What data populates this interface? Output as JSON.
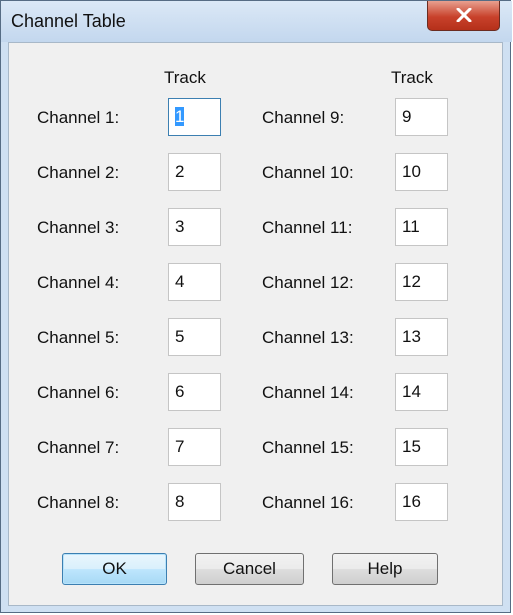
{
  "window": {
    "title": "Channel Table"
  },
  "headers": {
    "col1": "Track",
    "col2": "Track"
  },
  "left": [
    {
      "label": "Channel 1:",
      "value": "1"
    },
    {
      "label": "Channel 2:",
      "value": "2"
    },
    {
      "label": "Channel 3:",
      "value": "3"
    },
    {
      "label": "Channel 4:",
      "value": "4"
    },
    {
      "label": "Channel 5:",
      "value": "5"
    },
    {
      "label": "Channel 6:",
      "value": "6"
    },
    {
      "label": "Channel 7:",
      "value": "7"
    },
    {
      "label": "Channel 8:",
      "value": "8"
    }
  ],
  "right": [
    {
      "label": "Channel 9:",
      "value": "9"
    },
    {
      "label": "Channel 10:",
      "value": "10"
    },
    {
      "label": "Channel 11:",
      "value": "11"
    },
    {
      "label": "Channel 12:",
      "value": "12"
    },
    {
      "label": "Channel 13:",
      "value": "13"
    },
    {
      "label": "Channel 14:",
      "value": "14"
    },
    {
      "label": "Channel 15:",
      "value": "15"
    },
    {
      "label": "Channel 16:",
      "value": "16"
    }
  ],
  "buttons": {
    "ok": "OK",
    "cancel": "Cancel",
    "help": "Help"
  },
  "icons": {
    "close": "close-icon"
  }
}
